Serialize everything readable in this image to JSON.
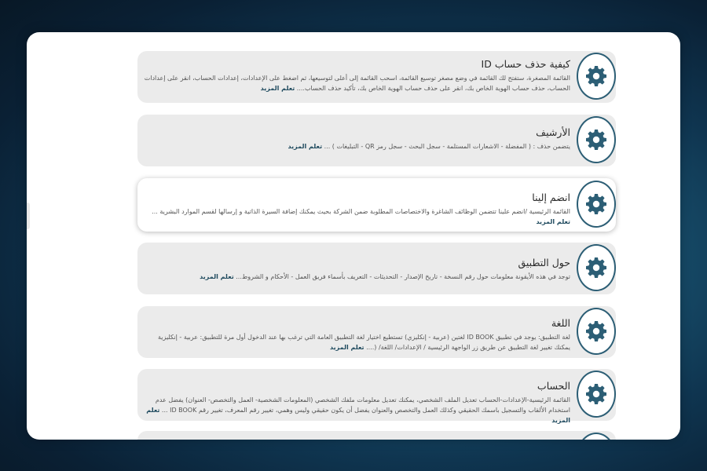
{
  "cards": [
    {
      "title": "كيفية حذف حساب ID",
      "desc": "القائمة المصغرة، ستفتح لك القائمة في وضع مصغر  توسيع القائمة، اسحب القائمة إلى أعلى لتوسيعها، ثم اضغط على الإعدادات، إعدادات الحساب، انقر على إعدادات الحساب، حذف حساب الهوية الخاص بك، انقر على حذف حساب الهوية الخاص بك، تأكيد حذف الحساب.... ",
      "more": "تعلم المزيد"
    },
    {
      "title": "الأرشيف",
      "desc": "يتضمن حذف : ( المفضلة - الاشعارات المستلمة - سجل البحث - سجل رمز QR - التبليغات ) ... ",
      "more": "تعلم المزيد"
    },
    {
      "title": "انضم إلينا",
      "desc": "القائمة الرئيسية /انضم علينا تتضمن الوظائف الشاغرة والاختصاصات المطلوبة ضمن الشركة بحيث يمكنك إضافة السيرة الذاتية و إرسالها لقسم الموارد البشرية ... ",
      "more": "تعلم المزيد"
    },
    {
      "title": "حول التطبيق",
      "desc": "توجد في هذه الأيقونة معلومات حول رقم النسخة -  تاريخ الإصدار - التحديثات - التعريف بأسماء فريق العمل - الأحكام و الشروط... ",
      "more": "تعلم المزيد"
    },
    {
      "title": "اللغة",
      "desc": "لغة التطبيق:  يوجد في تطبيق  ID BOOK  لغتين (عربية - إنكليزي) تستطيع اختيار لغة التطبيق العامة التي ترغب بها عند الدخول أول مرة للتطبيق: عربية - إنكليزية يمكنك تغيير لغة التطبيق عن طريق زر الواجهة الرئيسية / الإعدادات/ اللغة/ (.... ",
      "more": "تعلم المزيد"
    },
    {
      "title": "الحساب",
      "desc": "القائمة الرئيسية-الإعدادات-الحساب تعديل الملف الشخصي، يمكنك تعديل معلومات ملفك الشخصي (المعلومات الشخصية- العمل والتخصص- العنوان)  يفضل عدم استخدام الألقاب والتسجيل باسمك الحقيقي وكذلك العمل والتخصص والعنوان يفضل أن يكون حقيقي وليس وهمي، تغيير رقم المعرف،  تغيير رقم ID BOOK ... ",
      "more": "تعلم المزيد"
    },
    {
      "title": "",
      "desc": "",
      "more": ""
    }
  ]
}
